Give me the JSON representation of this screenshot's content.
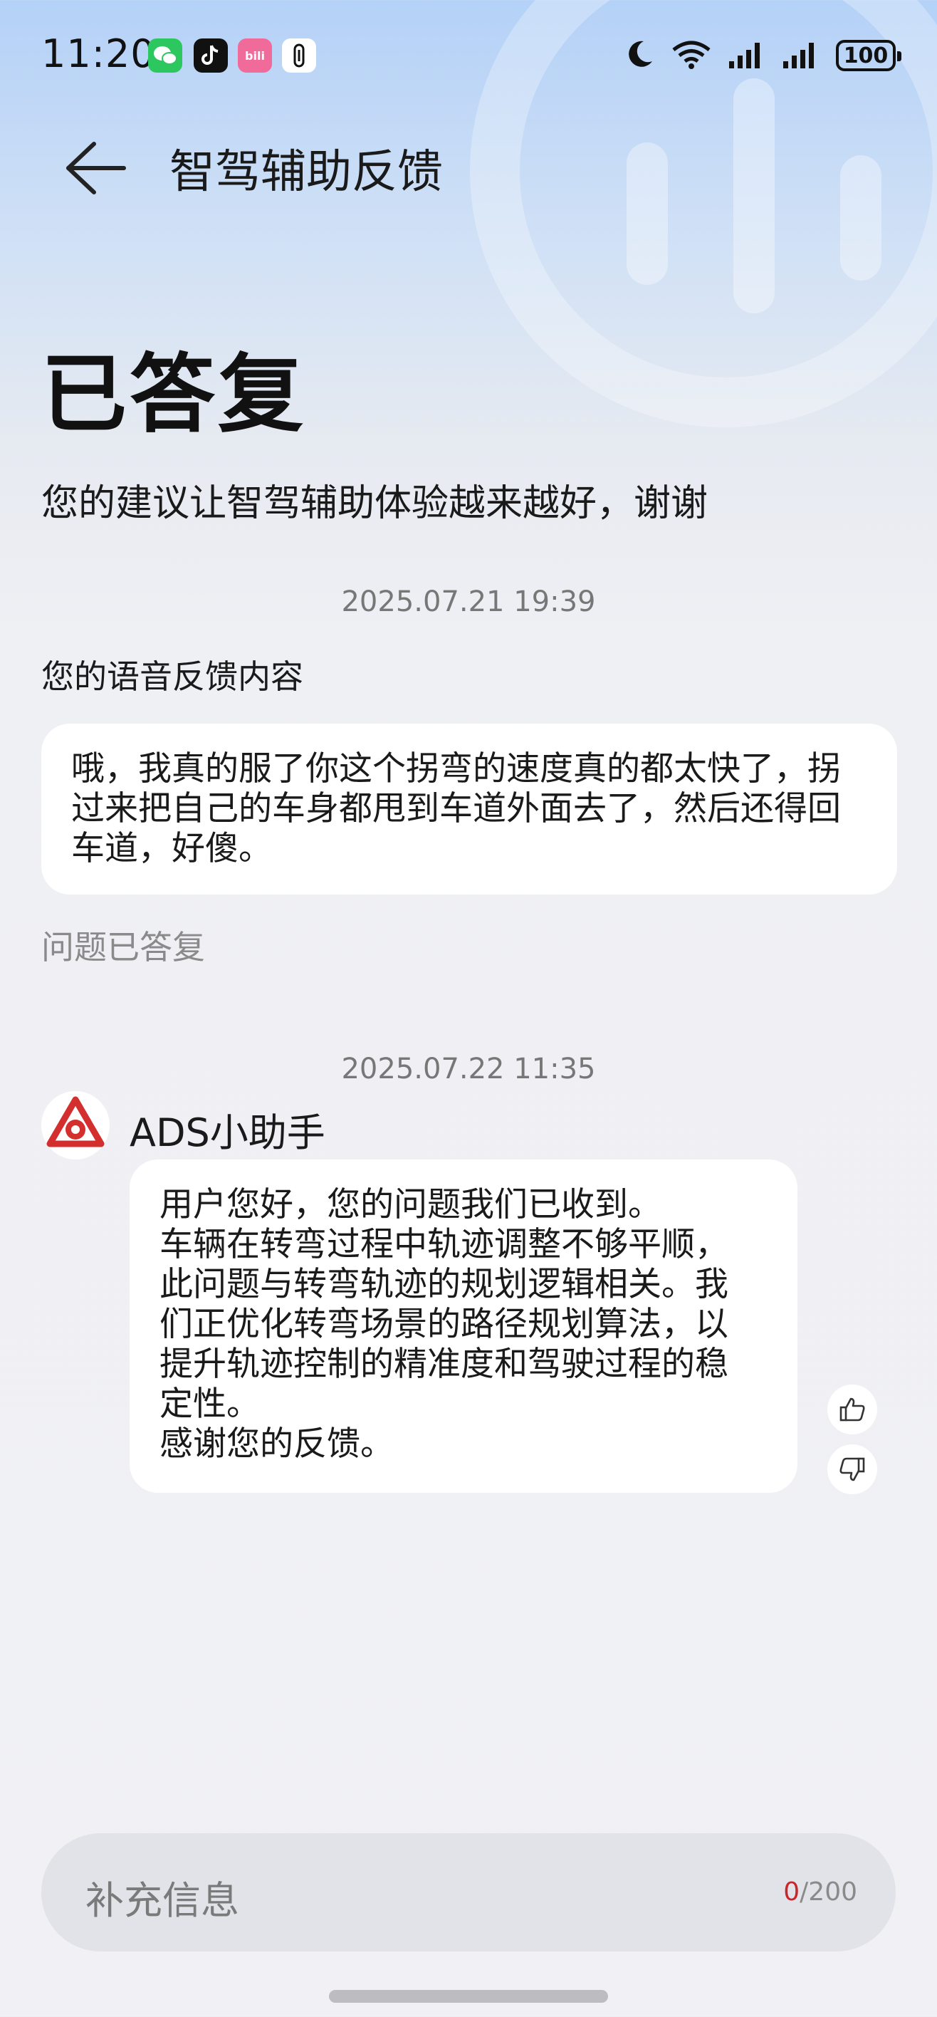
{
  "status_bar": {
    "time": "11:20",
    "apps": [
      "wechat-icon",
      "tiktok-icon",
      "bilibili-icon",
      "app-icon"
    ],
    "battery": "100",
    "icons": [
      "moon-icon",
      "wifi-icon",
      "signal-icon",
      "signal-icon"
    ]
  },
  "header": {
    "title": "智驾辅助反馈"
  },
  "result": {
    "status": "已答复",
    "subtitle": "您的建议让智驾辅助体验越来越好，谢谢"
  },
  "feedback": {
    "timestamp": "2025.07.21 19:39",
    "label": "您的语音反馈内容",
    "content": "哦，我真的服了你这个拐弯的速度真的都太快了，拐过来把自己的车身都甩到车道外面去了，然后还得回车道，好傻。",
    "state": "问题已答复"
  },
  "reply": {
    "timestamp": "2025.07.22 11:35",
    "name": "ADS小助手",
    "lines": [
      "用户您好，您的问题我们已收到。",
      "车辆在转弯过程中轨迹调整不够平顺，",
      "此问题与转弯轨迹的规划逻辑相关。我",
      "们正优化转弯场景的路径规划算法，以",
      "提升轨迹控制的精准度和驾驶过程的稳",
      "定性。",
      "感谢您的反馈。"
    ]
  },
  "input": {
    "placeholder": "补充信息",
    "count": "0",
    "max": "/200"
  },
  "colors": {
    "accent_red": "#c8262b",
    "bubble": "#ffffff",
    "background": "#f1f1f5"
  }
}
